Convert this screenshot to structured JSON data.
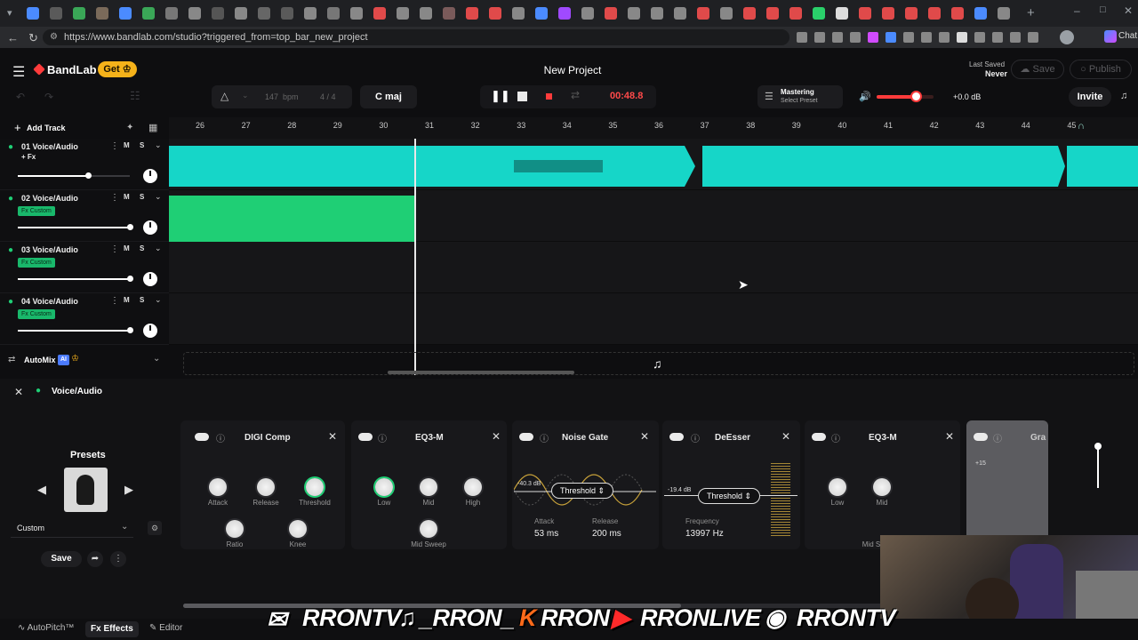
{
  "browser": {
    "url": "https://www.bandlab.com/studio?triggered_from=top_bar_new_project",
    "profile_label": "Chat"
  },
  "app": {
    "brand": "BandLab",
    "get_label": "Get",
    "project_title": "New Project",
    "last_saved_label": "Last Saved",
    "last_saved_value": "Never",
    "save_label": "Save",
    "publish_label": "Publish",
    "invite_label": "Invite",
    "bpm_value": "147",
    "bpm_unit": "bpm",
    "time_sig": "4 / 4",
    "key": "C maj",
    "time": "00:48.8",
    "mastering_label": "Mastering",
    "mastering_preset": "Select Preset",
    "master_db": "+0.0 dB",
    "master_volume_fraction": 0.68,
    "add_track_label": "Add Track",
    "automix_label": "AutoMix",
    "automix_ai": "AI"
  },
  "ruler": {
    "ticks": [
      "26",
      "27",
      "28",
      "29",
      "30",
      "31",
      "32",
      "33",
      "34",
      "35",
      "36",
      "37",
      "38",
      "39",
      "40",
      "41",
      "42",
      "43",
      "44",
      "45"
    ]
  },
  "tracks": [
    {
      "name": "01 Voice/Audio",
      "tag": "+ Fx",
      "fx_badge": "",
      "vol": 0.63
    },
    {
      "name": "02 Voice/Audio",
      "tag": "",
      "fx_badge": "Fx Custom",
      "vol": 1.0
    },
    {
      "name": "03 Voice/Audio",
      "tag": "",
      "fx_badge": "Fx Custom",
      "vol": 1.0
    },
    {
      "name": "04 Voice/Audio",
      "tag": "",
      "fx_badge": "Fx Custom",
      "vol": 1.0
    }
  ],
  "track_buttons": {
    "mute": "M",
    "solo": "S"
  },
  "lower": {
    "track_label": "Voice/Audio",
    "presets_label": "Presets",
    "preset_value": "Custom",
    "save_label": "Save"
  },
  "plugins": {
    "digi_comp": {
      "title": "DIGI Comp",
      "knobs": [
        "Attack",
        "Release",
        "Threshold",
        "Ratio",
        "Knee"
      ]
    },
    "eq3m": {
      "title": "EQ3-M",
      "knobs": [
        "Low",
        "Mid",
        "High",
        "Mid Sweep"
      ]
    },
    "noise_gate": {
      "title": "Noise Gate",
      "threshold_label": "Threshold",
      "db_readout": "-40.3 dB",
      "attack_label": "Attack",
      "attack_value": "53 ms",
      "release_label": "Release",
      "release_value": "200 ms"
    },
    "deesser": {
      "title": "DeEsser",
      "threshold_label": "Threshold",
      "db_readout": "-19.4 dB",
      "freq_label": "Frequency",
      "freq_value": "13997 Hz"
    },
    "eq3m_2": {
      "title": "EQ3-M",
      "knobs": [
        "Low",
        "Mid",
        "Mid S"
      ]
    },
    "partial": {
      "title": "Gra",
      "scale_mark": "+15"
    }
  },
  "bottom_nav": {
    "autopitch": "AutoPitch™",
    "effects": "Effects",
    "editor": "Editor"
  },
  "overlay": {
    "text": "RRONTV  _RRON_  RRON  RRONLIVE  RRONTV",
    "handle1": "RRONTV",
    "handle2": "_RRON_",
    "handle3": "RRON",
    "handle4": "RRONLIVE",
    "handle5": "RRONTV"
  },
  "colors": {
    "accent_red": "#ff3b3b",
    "track1_wave": "#16d6c8",
    "track2_clip": "#1fcf75",
    "get_badge": "#f5b21a"
  }
}
